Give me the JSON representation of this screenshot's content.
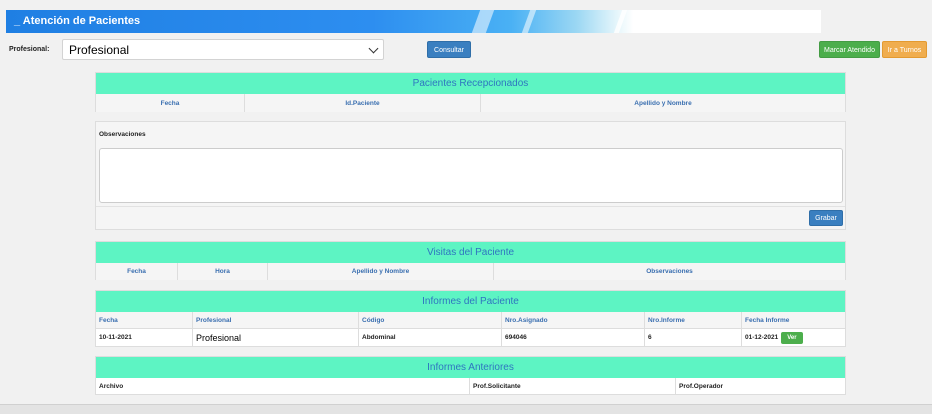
{
  "header": {
    "title": "_ Atención de Pacientes"
  },
  "filter": {
    "label": "Profesional:",
    "select_value": "Profesional",
    "consultar": "Consultar",
    "marcar_atendido": "Marcar Atendido",
    "ir_turnos": "Ir a Turnos"
  },
  "recepcionados": {
    "title": "Pacientes Recepcionados",
    "columns": [
      "Fecha",
      "Id.Paciente",
      "Apellido y Nombre"
    ]
  },
  "observaciones": {
    "label": "Observaciones",
    "value": "",
    "grabar": "Grabar"
  },
  "visitas": {
    "title": "Visitas del Paciente",
    "columns": [
      "Fecha",
      "Hora",
      "Apellido y Nombre",
      "Observaciones"
    ]
  },
  "informes": {
    "title": "Informes del Paciente",
    "columns": [
      "Fecha",
      "Profesional",
      "Código",
      "Nro.Asignado",
      "Nro.Informe",
      "Fecha Informe"
    ],
    "rows": [
      {
        "fecha": "10-11-2021",
        "profesional": "Profesional",
        "codigo": "Abdominal",
        "nro_asignado": "694046",
        "nro_informe": "6",
        "fecha_informe": "01-12-2021",
        "action": "Ver"
      }
    ]
  },
  "anteriores": {
    "title": "Informes Anteriores",
    "columns": [
      "Archivo",
      "Prof.Solicitante",
      "Prof.Operador"
    ]
  },
  "colors": {
    "panel_header": "#5df4c3",
    "primary_button": "#3a7fc0",
    "success_button": "#4cae4c",
    "warning_button": "#f0ad4e"
  }
}
